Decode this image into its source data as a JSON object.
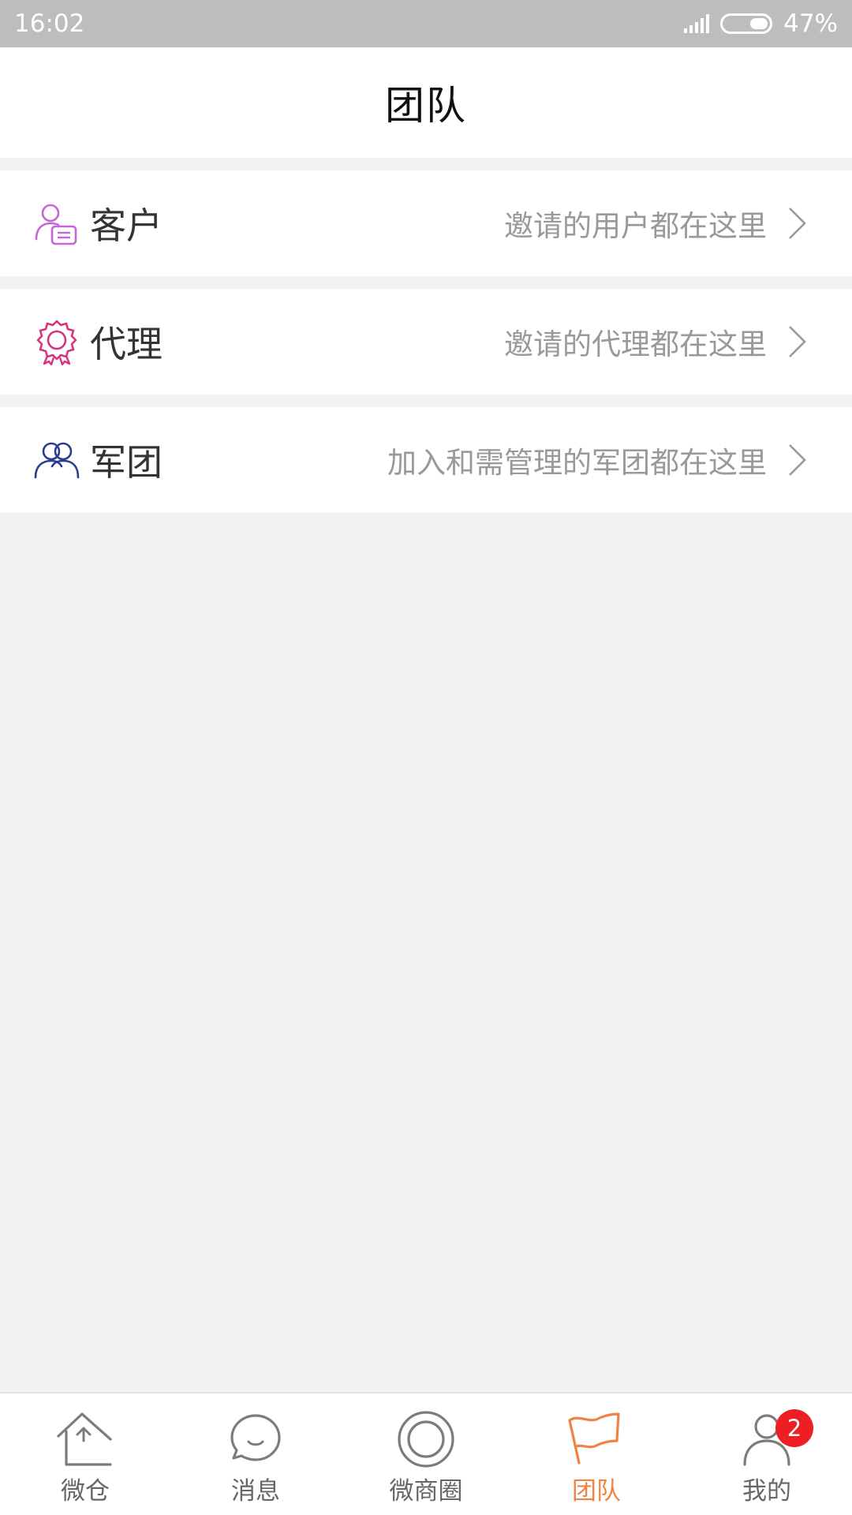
{
  "status_bar": {
    "time": "16:02",
    "battery": "47%"
  },
  "header": {
    "title": "团队"
  },
  "menu": [
    {
      "label": "客户",
      "description": "邀请的用户都在这里",
      "icon": "user-card-icon",
      "color": "#c566d6"
    },
    {
      "label": "代理",
      "description": "邀请的代理都在这里",
      "icon": "rosette-badge-icon",
      "color": "#d8337e"
    },
    {
      "label": "军团",
      "description": "加入和需管理的军团都在这里",
      "icon": "group-users-icon",
      "color": "#2b3d8f"
    }
  ],
  "tabs": [
    {
      "label": "微仓",
      "icon": "warehouse-house-icon",
      "active": false
    },
    {
      "label": "消息",
      "icon": "chat-bubble-icon",
      "active": false
    },
    {
      "label": "微商圈",
      "icon": "ring-circle-icon",
      "active": false
    },
    {
      "label": "团队",
      "icon": "flag-icon",
      "active": true
    },
    {
      "label": "我的",
      "icon": "profile-person-icon",
      "active": false,
      "badge": "2"
    }
  ],
  "colors": {
    "accent": "#f08344",
    "badge": "#ee1f24",
    "status_bar": "#bdbdbd"
  }
}
